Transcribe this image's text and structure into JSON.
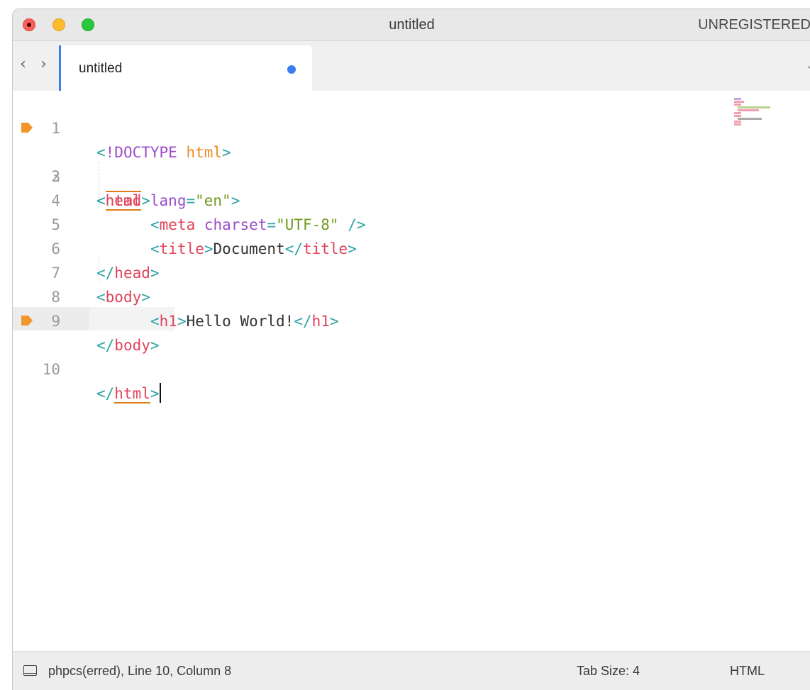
{
  "window": {
    "title": "untitled",
    "license_status": "UNREGISTERED"
  },
  "tabbar": {
    "back_glyph": "‹",
    "forward_glyph": "›",
    "active_tab": {
      "label": "untitled",
      "modified": true
    },
    "overflow_glyph": "⌄"
  },
  "editor": {
    "line_numbers": [
      "1",
      "2",
      "3",
      "4",
      "5",
      "6",
      "7",
      "8",
      "9",
      "10"
    ],
    "bookmarked_lines": [
      2,
      10
    ],
    "current_line": 10,
    "lines": [
      "<!DOCTYPE html>",
      "<html lang=\"en\">",
      "<head>",
      "    <meta charset=\"UTF-8\" />",
      "    <title>Document</title>",
      "</head>",
      "<body>",
      "    <h1>Hello World!</h1>",
      "</body>",
      "</html>"
    ],
    "tokens": {
      "l1": {
        "lt": "<",
        "doctype": "!DOCTYPE",
        "sp": " ",
        "html": "html",
        "gt": ">"
      },
      "l2": {
        "lt": "<",
        "tag": "html",
        "sp": " ",
        "attr": "lang",
        "eq": "=",
        "val": "\"en\"",
        "gt": ">"
      },
      "l3": {
        "lt": "<",
        "tag": "head",
        "gt": ">"
      },
      "l4": {
        "lt": "<",
        "tag": "meta",
        "sp": " ",
        "attr": "charset",
        "eq": "=",
        "val": "\"UTF-8\"",
        "close": " />"
      },
      "l5": {
        "lt": "<",
        "tag": "title",
        "gt": ">",
        "text": "Document",
        "lt2": "</",
        "tag2": "title",
        "gt2": ">"
      },
      "l6": {
        "lt": "</",
        "tag": "head",
        "gt": ">"
      },
      "l7": {
        "lt": "<",
        "tag": "body",
        "gt": ">"
      },
      "l8": {
        "lt": "<",
        "tag": "h1",
        "gt": ">",
        "text": "Hello World!",
        "lt2": "</",
        "tag2": "h1",
        "gt2": ">"
      },
      "l9": {
        "lt": "</",
        "tag": "body",
        "gt": ">"
      },
      "l10": {
        "lt": "</",
        "tag": "html",
        "gt": ">"
      }
    }
  },
  "colors": {
    "punctuation": "#2ea3a3",
    "tag": "#e0445a",
    "keyword": "#9b4dca",
    "string": "#6f9a1f",
    "bookmark": "#f0962c",
    "tab_accent": "#3b7cf0"
  },
  "statusbar": {
    "panel_icon": "panel-toggle-icon",
    "message": "phpcs(erred), Line 10, Column 8",
    "tab_size": "Tab Size: 4",
    "syntax": "HTML"
  }
}
